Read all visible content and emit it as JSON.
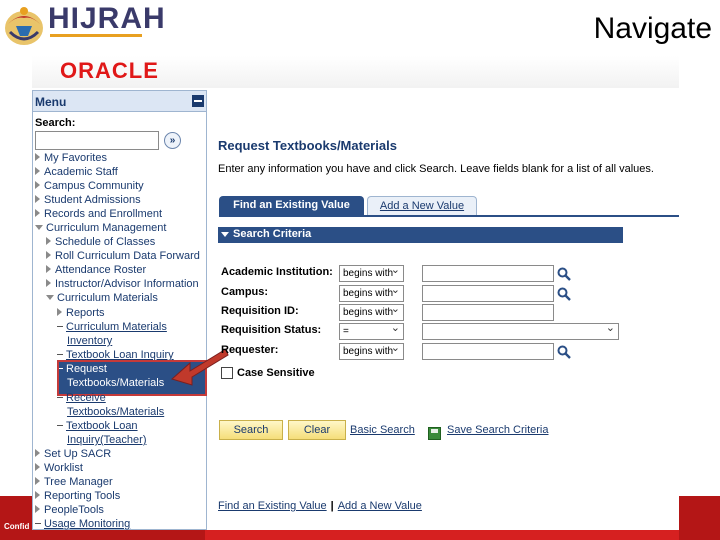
{
  "slide": {
    "logo_text": "HIJRAH",
    "title": "Navigate",
    "footer_text": "Confid"
  },
  "oracle": {
    "logo": "ORACLE"
  },
  "menu": {
    "title": "Menu",
    "search_label": "Search:",
    "search_value": "",
    "items": [
      {
        "label": "My Favorites"
      },
      {
        "label": "Academic Staff"
      },
      {
        "label": "Campus Community"
      },
      {
        "label": "Student Admissions"
      },
      {
        "label": "Records and Enrollment"
      },
      {
        "label": "Curriculum Management"
      },
      {
        "label": "Schedule of Classes"
      },
      {
        "label": "Roll Curriculum Data Forward"
      },
      {
        "label": "Attendance Roster"
      },
      {
        "label": "Instructor/Advisor Information"
      },
      {
        "label": "Curriculum Materials"
      },
      {
        "label": "Reports"
      },
      {
        "label": "Curriculum Materials"
      },
      {
        "label": "Inventory"
      },
      {
        "label": "Textbook Loan Inquiry"
      },
      {
        "label": "Request"
      },
      {
        "label": "Textbooks/Materials"
      },
      {
        "label": "Receive"
      },
      {
        "label": "Textbooks/Materials"
      },
      {
        "label": "Textbook Loan"
      },
      {
        "label": "Inquiry(Teacher)"
      },
      {
        "label": "Set Up SACR"
      },
      {
        "label": "Worklist"
      },
      {
        "label": "Tree Manager"
      },
      {
        "label": "Reporting Tools"
      },
      {
        "label": "PeopleTools"
      },
      {
        "label": "Usage Monitoring"
      }
    ]
  },
  "main": {
    "title": "Request Textbooks/Materials",
    "instructions": "Enter any information you have and click Search. Leave fields blank for a list of all values.",
    "tabs": [
      {
        "label": "Find an Existing Value"
      },
      {
        "label": "Add a New Value"
      }
    ],
    "criteria_label": "Search Criteria",
    "fields": [
      {
        "label": "Academic Institution:",
        "operator": "begins with"
      },
      {
        "label": "Campus:",
        "operator": "begins with"
      },
      {
        "label": "Requisition ID:",
        "operator": "begins with"
      },
      {
        "label": "Requisition Status:",
        "operator": "="
      },
      {
        "label": "Requester:",
        "operator": "begins with"
      }
    ],
    "case_sensitive_label": "Case Sensitive",
    "search_button": "Search",
    "clear_button": "Clear",
    "basic_search_link": "Basic Search",
    "save_criteria_link": "Save Search Criteria",
    "bottom_links": [
      {
        "label": "Find an Existing Value"
      },
      {
        "label": "Add a New Value"
      }
    ],
    "bottom_sep": "|"
  },
  "colors": {
    "accent": "#2b4f86",
    "highlight": "#c43a3a",
    "footer": "#d62020",
    "oracle_red": "#e01818"
  }
}
